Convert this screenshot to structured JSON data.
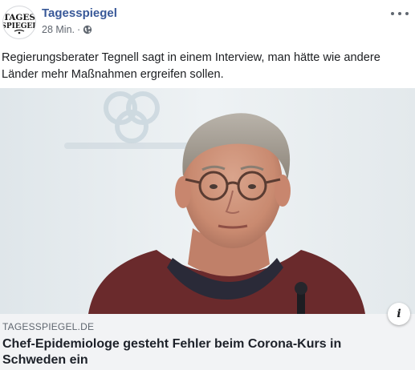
{
  "post": {
    "page_name": "Tagesspiegel",
    "timestamp": "28 Min.",
    "separator": "·",
    "privacy_icon": "globe-icon",
    "avatar_logo_text": [
      "TAGES",
      "SPIEGEL"
    ],
    "more_icon": "more-horizontal-icon",
    "text": "Regierungsberater Tegnell sagt in einem Interview, man hätte wie andere Länder mehr Maßnahmen ergreifen sollen."
  },
  "link_preview": {
    "domain": "TAGESSPIEGEL.DE",
    "headline": "Chef-Epidemiologe gesteht Fehler beim Corona-Kurs in Schweden ein",
    "info_label": "i",
    "info_icon": "info-icon"
  },
  "colors": {
    "page_name": "#385898",
    "meta": "#616770",
    "link_bg": "#f2f3f5"
  }
}
